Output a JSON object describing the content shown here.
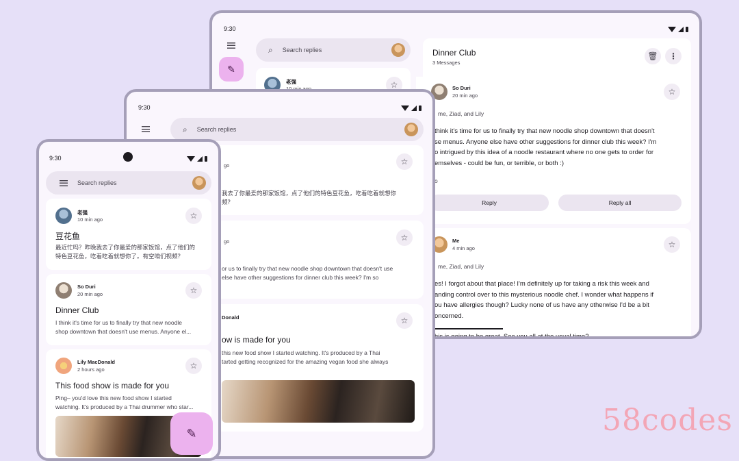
{
  "status_time": "9:30",
  "search_placeholder": "Search replies",
  "tablet": {
    "list_sender": "老强",
    "list_time": "10 min ago",
    "detail": {
      "title": "Dinner Club",
      "count": "3 Messages",
      "thread": [
        {
          "sender": "So Duri",
          "time": "20 min ago",
          "to": "me, Ziad, and Lily",
          "body_lines": [
            "think it's time for us to finally try that new noodle shop downtown that doesn't",
            "se menus. Anyone else have other suggestions for dinner club this week? I'm",
            "o intrigued by this idea of a noodle restaurant where no one gets to order for",
            "emselves - could be fun, or terrible, or both :)"
          ],
          "sign": "o",
          "reply_label": "Reply",
          "reply_all_label": "Reply all"
        },
        {
          "sender": "Me",
          "time": "4 min ago",
          "to": "me, Ziad, and Lily",
          "body_lines": [
            "es! I forgot about that place! I'm definitely up for taking a risk this week and",
            "anding control over to this mysterious noodle chef. I wonder what happens if",
            "ou have allergies though? Lucky none of us have any otherwise I'd be a bit",
            "oncerned."
          ],
          "cut_line": "his is going to be great. See you all at the usual time?"
        }
      ]
    }
  },
  "foldable": {
    "cards": [
      {
        "time": "go",
        "preview_lines": [
          "我去了你最爱的那家饭馆，点了他们的特色豆花鱼，吃着吃着就想你",
          "频？"
        ]
      },
      {
        "time": "go",
        "preview_lines": [
          "or us to finally try that new noodle shop downtown that doesn't use",
          "else have other suggestions for dinner club this week? I'm so"
        ]
      },
      {
        "sender": "Donald",
        "subject": "ow is made for you",
        "preview_lines": [
          "this new food show I started watching. It's produced by a Thai",
          "tarted getting recognized for the amazing vegan food she always"
        ]
      }
    ]
  },
  "phone": {
    "cards": [
      {
        "sender": "老强",
        "time": "10 min ago",
        "subject": "豆花鱼",
        "preview_lines": [
          "最近忙吗？昨晚我去了你最爱的那家饭馆，点了他们的",
          "特色豆花鱼，吃着吃着就想你了。有空咱们视频？"
        ]
      },
      {
        "sender": "So Duri",
        "time": "20 min ago",
        "subject": "Dinner Club",
        "preview_lines": [
          "I think it's time for us to finally try that new noodle",
          "shop downtown that doesn't use menus. Anyone el..."
        ]
      },
      {
        "sender": "Lily MacDonald",
        "time": "2 hours ago",
        "subject": "This food show is made for you",
        "preview_lines": [
          "Ping– you'd love this new food show I started",
          "watching. It's produced by a Thai drummer who star..."
        ]
      }
    ]
  },
  "watermark": "58codes",
  "icons": {
    "star": "star-icon",
    "pencil": "pencil-icon",
    "trash": "trash-icon",
    "more": "more-vert-icon",
    "search": "search-icon",
    "menu": "menu-icon"
  },
  "colors": {
    "background": "#e6e0f8",
    "surface": "#faf6fd",
    "fab": "#ecb2ee",
    "frame": "#a59fb8"
  }
}
